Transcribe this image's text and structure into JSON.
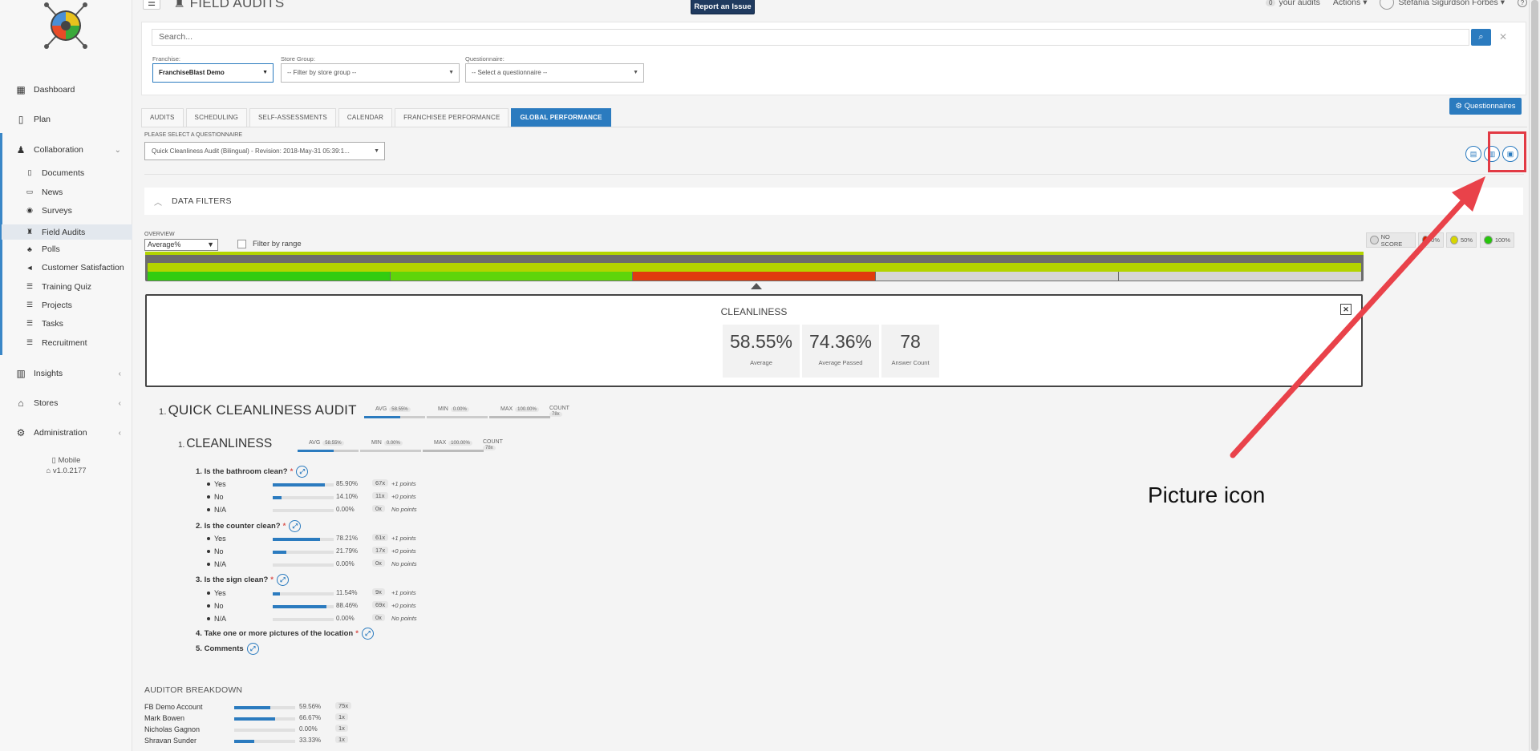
{
  "sidebar": {
    "items": [
      {
        "label": "Dashboard",
        "icon": "grid-icon"
      },
      {
        "label": "Plan",
        "icon": "map-icon"
      },
      {
        "label": "Collaboration",
        "icon": "collaboration-icon"
      },
      {
        "label": "Insights",
        "icon": "chart-icon"
      },
      {
        "label": "Stores",
        "icon": "bank-icon"
      },
      {
        "label": "Administration",
        "icon": "gear-icon"
      }
    ],
    "collaboration_items": [
      {
        "label": "Documents",
        "icon": "document-icon"
      },
      {
        "label": "News",
        "icon": "news-icon"
      },
      {
        "label": "Surveys",
        "icon": "survey-icon"
      },
      {
        "label": "Field Audits",
        "icon": "trophy-icon"
      },
      {
        "label": "Polls",
        "icon": "bell-icon"
      },
      {
        "label": "Customer Satisfaction",
        "icon": "megaphone-icon"
      },
      {
        "label": "Training Quiz",
        "icon": "list-icon"
      },
      {
        "label": "Projects",
        "icon": "list-icon"
      },
      {
        "label": "Tasks",
        "icon": "list-icon"
      },
      {
        "label": "Recruitment",
        "icon": "list-icon"
      }
    ],
    "mobile_label": "Mobile",
    "version": "v1.0.2177"
  },
  "header": {
    "title": "FIELD AUDITS",
    "report_issue": "Report an Issue",
    "audits_count": "0",
    "audits_label": "your audits",
    "actions_label": "Actions",
    "user_name": "Stefania Sigurdson Forbes",
    "help": "?"
  },
  "filters": {
    "search_placeholder": "Search...",
    "franchise_label": "Franchise:",
    "franchise_value": "FranchiseBlast Demo",
    "store_group_label": "Store Group:",
    "store_group_value": "-- Filter by store group --",
    "questionnaire_label": "Questionnaire:",
    "questionnaire_value": "-- Select a questionnaire --"
  },
  "questionnaires_button": "Questionnaires",
  "tabs": [
    "AUDITS",
    "SCHEDULING",
    "SELF-ASSESSMENTS",
    "CALENDAR",
    "FRANCHISEE PERFORMANCE",
    "GLOBAL PERFORMANCE"
  ],
  "active_tab": "GLOBAL PERFORMANCE",
  "questionnaire_select": {
    "label": "PLEASE SELECT A QUESTIONNAIRE",
    "value": "Quick Cleanliness Audit (Bilingual) - Revision: 2018-May-31 05:39:1..."
  },
  "data_filters_title": "DATA FILTERS",
  "overview": {
    "label": "OVERVIEW",
    "value": "Average%",
    "filter_by_range": "Filter by range"
  },
  "legend": [
    {
      "label": "NO SCORE",
      "color": "#d8d8d8"
    },
    {
      "label": "0%",
      "color": "#d62000"
    },
    {
      "label": "50%",
      "color": "#d7d600"
    },
    {
      "label": "100%",
      "color": "#27c50c"
    }
  ],
  "overview_bar": {
    "segments": [
      {
        "color": "#32cc10"
      },
      {
        "color": "#5fd50a"
      },
      {
        "color": "#e03b0e"
      },
      {
        "color": "#d6d6d6"
      },
      {
        "color": "#d6d6d6"
      }
    ]
  },
  "detail": {
    "title": "CLEANLINESS",
    "stats": [
      {
        "value": "58.55%",
        "label": "Average"
      },
      {
        "value": "74.36%",
        "label": "Average Passed"
      },
      {
        "value": "78",
        "label": "Answer Count"
      }
    ]
  },
  "audit": {
    "num": "1.",
    "title": "QUICK CLEANLINESS AUDIT",
    "avg_label": "AVG",
    "avg": "58.55%",
    "avg_fraction": 0.5855,
    "min_label": "MIN",
    "min": "0.00%",
    "min_fraction": 0,
    "max_label": "MAX",
    "max": "100.00%",
    "max_fraction": 1,
    "count_label": "COUNT",
    "count": "78x"
  },
  "section": {
    "num": "1.",
    "title": "CLEANLINESS",
    "avg_label": "AVG",
    "avg": "58.55%",
    "avg_fraction": 0.5855,
    "min_label": "MIN",
    "min": "0.00%",
    "min_fraction": 0,
    "max_label": "MAX",
    "max": "100.00%",
    "max_fraction": 1,
    "count_label": "COUNT",
    "count": "78x"
  },
  "questions": [
    {
      "num": "1.",
      "text": "Is the bathroom clean?",
      "required": true,
      "answers": [
        {
          "label": "Yes",
          "pct": "85.90%",
          "fraction": 0.859,
          "count": "67x",
          "points": "+1 points"
        },
        {
          "label": "No",
          "pct": "14.10%",
          "fraction": 0.141,
          "count": "11x",
          "points": "+0 points"
        },
        {
          "label": "N/A",
          "pct": "0.00%",
          "fraction": 0,
          "count": "0x",
          "points": "No points"
        }
      ]
    },
    {
      "num": "2.",
      "text": "Is the counter clean?",
      "required": true,
      "answers": [
        {
          "label": "Yes",
          "pct": "78.21%",
          "fraction": 0.7821,
          "count": "61x",
          "points": "+1 points"
        },
        {
          "label": "No",
          "pct": "21.79%",
          "fraction": 0.2179,
          "count": "17x",
          "points": "+0 points"
        },
        {
          "label": "N/A",
          "pct": "0.00%",
          "fraction": 0,
          "count": "0x",
          "points": "No points"
        }
      ]
    },
    {
      "num": "3.",
      "text": "Is the sign clean?",
      "required": true,
      "answers": [
        {
          "label": "Yes",
          "pct": "11.54%",
          "fraction": 0.1154,
          "count": "9x",
          "points": "+1 points"
        },
        {
          "label": "No",
          "pct": "88.46%",
          "fraction": 0.8846,
          "count": "69x",
          "points": "+0 points"
        },
        {
          "label": "N/A",
          "pct": "0.00%",
          "fraction": 0,
          "count": "0x",
          "points": "No points"
        }
      ]
    },
    {
      "num": "4.",
      "text": "Take one or more pictures of the location",
      "required": true,
      "answers": []
    },
    {
      "num": "5.",
      "text": "Comments",
      "required": false,
      "answers": []
    }
  ],
  "auditor_breakdown": {
    "title": "AUDITOR BREAKDOWN",
    "rows": [
      {
        "name": "FB Demo Account",
        "pct": "59.56%",
        "fraction": 0.5956,
        "count": "75x"
      },
      {
        "name": "Mark Bowen",
        "pct": "66.67%",
        "fraction": 0.6667,
        "count": "1x"
      },
      {
        "name": "Nicholas Gagnon",
        "pct": "0.00%",
        "fraction": 0,
        "count": "1x"
      },
      {
        "name": "Shravan Sunder",
        "pct": "33.33%",
        "fraction": 0.3333,
        "count": "1x"
      }
    ]
  },
  "annotation": "Picture icon"
}
